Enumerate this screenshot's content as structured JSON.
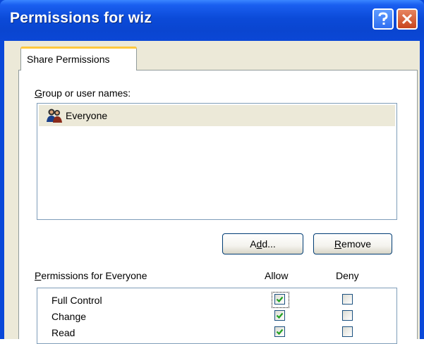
{
  "window": {
    "title": "Permissions for wiz"
  },
  "icons": {
    "help": "help-icon",
    "close": "close-icon",
    "group": "user-group-icon"
  },
  "tab": {
    "label": "Share Permissions"
  },
  "group_section": {
    "label_accel": "G",
    "label_rest": "roup or user names:",
    "items": [
      {
        "name": "Everyone",
        "selected": true
      }
    ]
  },
  "buttons": {
    "add_pre": "A",
    "add_accel": "d",
    "add_post": "d...",
    "remove_accel": "R",
    "remove_rest": "emove"
  },
  "permissions": {
    "label_accel": "P",
    "label_rest": "ermissions for Everyone",
    "allow_header": "Allow",
    "deny_header": "Deny",
    "rows": [
      {
        "name": "Full Control",
        "allow": true,
        "deny": false
      },
      {
        "name": "Change",
        "allow": true,
        "deny": false
      },
      {
        "name": "Read",
        "allow": true,
        "deny": false
      }
    ]
  },
  "colors": {
    "titlebar": "#0a48d9",
    "dialog_bg": "#ece9d8",
    "selection": "#ece9d8",
    "check": "#21a121"
  }
}
